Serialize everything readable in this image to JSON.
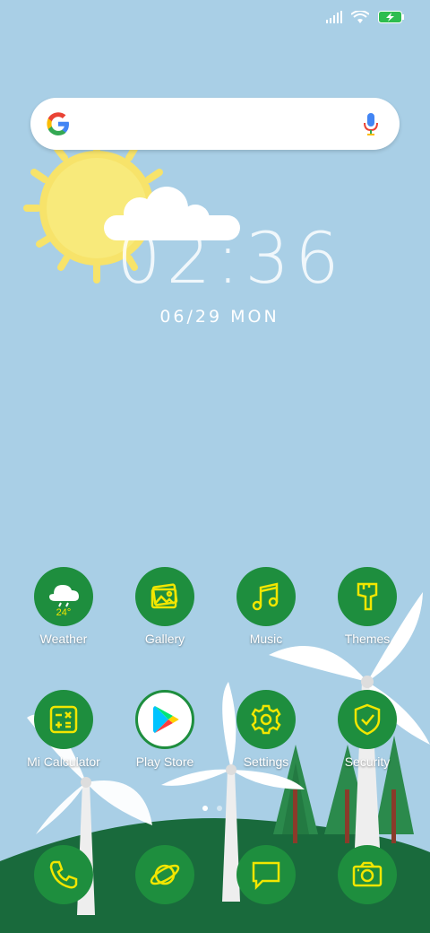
{
  "status_bar": {
    "icons": [
      "signal-icon",
      "wifi-icon",
      "battery-charging-icon"
    ]
  },
  "search": {
    "logo": "google-logo",
    "icon_right": "mic-icon"
  },
  "clock": {
    "time": "02:36",
    "date": "06/29 MON"
  },
  "weather_widget": {
    "icon": "sun-cloud-icon"
  },
  "apps": [
    {
      "label": "Weather",
      "icon": "weather-rain-cloud-icon",
      "temp": "24°"
    },
    {
      "label": "Gallery",
      "icon": "gallery-icon"
    },
    {
      "label": "Music",
      "icon": "music-note-icon"
    },
    {
      "label": "Themes",
      "icon": "paint-brush-icon"
    },
    {
      "label": "Mi Calculator",
      "icon": "calculator-icon"
    },
    {
      "label": "Play Store",
      "icon": "play-store-icon"
    },
    {
      "label": "Settings",
      "icon": "gear-icon"
    },
    {
      "label": "Security",
      "icon": "shield-check-icon"
    }
  ],
  "page_indicator": {
    "pages": 2,
    "current": 1
  },
  "dock": [
    {
      "name": "phone",
      "icon": "phone-icon"
    },
    {
      "name": "browser",
      "icon": "planet-icon"
    },
    {
      "name": "messages",
      "icon": "message-icon"
    },
    {
      "name": "camera",
      "icon": "camera-icon"
    }
  ],
  "colors": {
    "sky": "#a9cfe6",
    "hill": "#196a3c",
    "icon_bg": "#1e8e3e",
    "icon_fg": "#f2e600"
  }
}
